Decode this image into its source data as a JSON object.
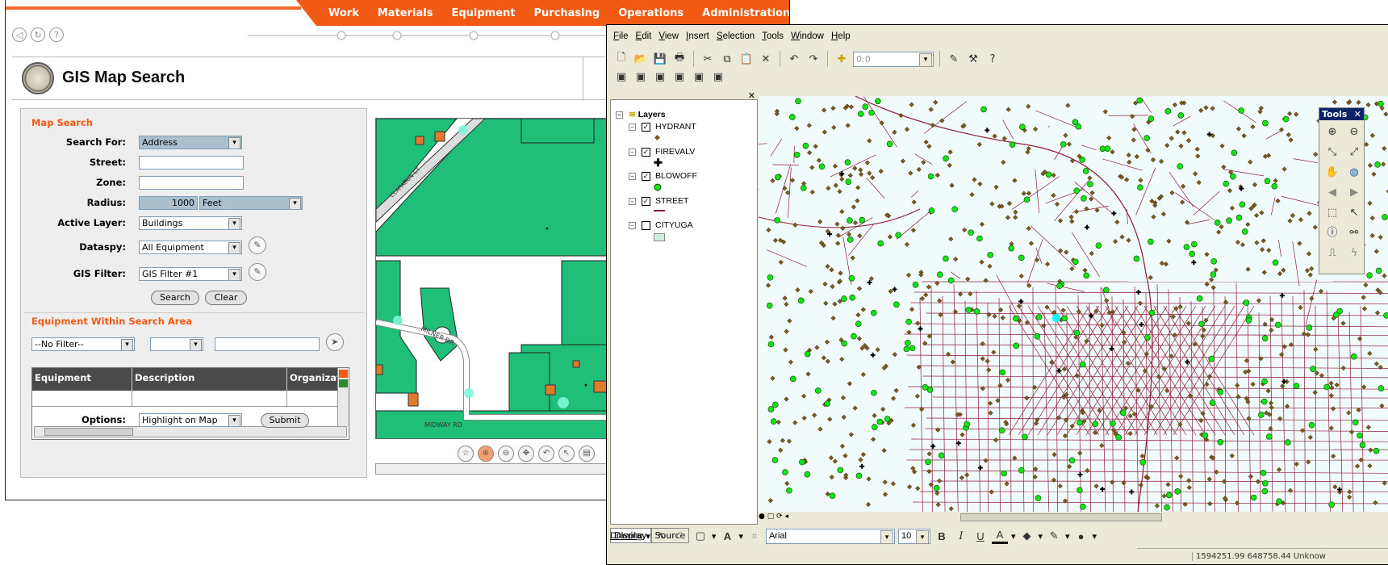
{
  "webapp": {
    "nav": [
      "Work",
      "Materials",
      "Equipment",
      "Purchasing",
      "Operations",
      "Administration"
    ],
    "title": "GIS Map Search",
    "map_search": {
      "heading": "Map Search",
      "search_for_label": "Search For:",
      "search_for_value": "Address",
      "street_label": "Street:",
      "street_value": "",
      "zone_label": "Zone:",
      "zone_value": "",
      "radius_label": "Radius:",
      "radius_value": "1000",
      "radius_unit": "Feet",
      "active_layer_label": "Active Layer:",
      "active_layer_value": "Buildings",
      "dataspy_label": "Dataspy:",
      "dataspy_value": "All Equipment",
      "gis_filter_label": "GIS Filter:",
      "gis_filter_value": "GIS Filter #1",
      "search_button": "Search",
      "clear_button": "Clear"
    },
    "equipment": {
      "heading": "Equipment Within Search Area",
      "filter_value": "--No Filter--",
      "filter_op": "",
      "filter_text": "",
      "columns": [
        "Equipment",
        "Description",
        "Organizatio"
      ],
      "options_label": "Options:",
      "options_value": "Highlight on Map",
      "submit_button": "Submit"
    },
    "map_labels": [
      "CLARABUN CT",
      "MILNER DR",
      "MIDWAY RD"
    ]
  },
  "arcmap": {
    "menu": [
      "File",
      "Edit",
      "View",
      "Insert",
      "Selection",
      "Tools",
      "Window",
      "Help"
    ],
    "scale_value": "0:0",
    "toc": {
      "root": "Layers",
      "layers": [
        {
          "name": "HYDRANT",
          "checked": true
        },
        {
          "name": "FIREVALV",
          "checked": true
        },
        {
          "name": "BLOWOFF",
          "checked": true
        },
        {
          "name": "STREET",
          "checked": true
        },
        {
          "name": "CITYUGA",
          "checked": false
        }
      ],
      "tabs": [
        "Display",
        "Source"
      ]
    },
    "tools_title": "Tools",
    "drawing_label": "Drawing",
    "font_name": "Arial",
    "font_size": "10",
    "status": "1594251.99  648758.44 Unknow",
    "colors": {
      "hydrant": "#7a5a1e",
      "blowoff": "#14e414",
      "street": "#8c1c3a",
      "fire": "#000000",
      "selection": "#00ffff"
    }
  }
}
